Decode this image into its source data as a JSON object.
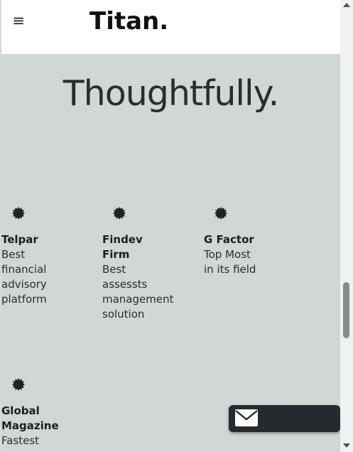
{
  "navbar": {
    "menu_icon": "hamburger-menu-icon",
    "menu_glyph": "≡",
    "brand": "Titan."
  },
  "hero": {
    "title": "Thoughtfully."
  },
  "features": [
    {
      "icon": "seal-badge-icon",
      "name": "Telpar",
      "desc": "Best financial advisory platform"
    },
    {
      "icon": "seal-badge-icon",
      "name": "Findev Firm",
      "desc": "Best assessts management solution"
    },
    {
      "icon": "seal-badge-icon",
      "name": "G Factor",
      "desc": "Top Most in its field"
    },
    {
      "icon": "seal-badge-icon",
      "name": "Global Magazine",
      "desc": "Fastest"
    }
  ],
  "contact_button": {
    "icon": "envelope-icon"
  },
  "colors": {
    "page_background": "#d1d6d7",
    "navbar_background": "#ffffff",
    "text": "#2b2b2b",
    "button_background": "#26292d"
  }
}
